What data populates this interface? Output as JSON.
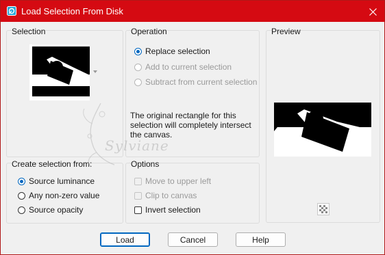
{
  "window": {
    "title": "Load Selection From Disk",
    "accent": "#d50a12"
  },
  "selection_group": {
    "label": "Selection"
  },
  "operation_group": {
    "label": "Operation",
    "options": [
      {
        "label": "Replace selection",
        "checked": true,
        "enabled": true
      },
      {
        "label": "Add to current selection",
        "checked": false,
        "enabled": false
      },
      {
        "label": "Subtract from current selection",
        "checked": false,
        "enabled": false
      }
    ],
    "note": "The original rectangle for this selection will completely intersect the canvas."
  },
  "preview_group": {
    "label": "Preview"
  },
  "create_from_group": {
    "label": "Create selection from:",
    "options": [
      {
        "label": "Source luminance",
        "checked": true
      },
      {
        "label": "Any non-zero value",
        "checked": false
      },
      {
        "label": "Source opacity",
        "checked": false
      }
    ]
  },
  "options_group": {
    "label": "Options",
    "items": [
      {
        "label": "Move to upper left",
        "checked": false,
        "enabled": false
      },
      {
        "label": "Clip to canvas",
        "checked": false,
        "enabled": false
      },
      {
        "label": "Invert selection",
        "checked": false,
        "enabled": true
      }
    ]
  },
  "buttons": {
    "load": "Load",
    "cancel": "Cancel",
    "help": "Help"
  },
  "watermark": {
    "text": "Sylviane"
  }
}
